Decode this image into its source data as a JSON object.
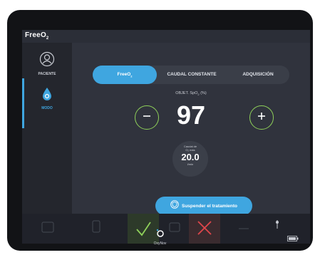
{
  "app": {
    "title": "Free",
    "title_sub": "O",
    "title_sub2": "2"
  },
  "sidebar": {
    "items": [
      {
        "label": "PACIENTE",
        "icon": "patient-icon"
      },
      {
        "label": "MODO",
        "icon": "oxygen-drop-icon"
      }
    ]
  },
  "tabs": [
    {
      "label": "FreeO",
      "label_sub": "2",
      "active": true
    },
    {
      "label": "CAUDAL CONSTANTE",
      "active": false
    },
    {
      "label": "ADQUISICIÓN",
      "active": false
    }
  ],
  "objective": {
    "label": "OBJET. SpO",
    "label_sub": "2",
    "label_unit": "(%)",
    "value": "97"
  },
  "flow": {
    "label_line1": "Caudal de",
    "label_line2": "O₂ más",
    "value": "20.0",
    "unit": "l/min"
  },
  "suspend_button": {
    "label": "Suspender el tratamiento"
  },
  "bottom_bar": {
    "confirm_icon": "check-icon",
    "cancel_icon": "close-icon",
    "battery_icon": "battery-icon",
    "wifi_icon": "signal-icon"
  },
  "brand": {
    "name": "OxyNov"
  },
  "colors": {
    "accent": "#3fa6e0",
    "confirm": "#8fd15a",
    "cancel": "#e0464b",
    "background": "#2b2e37"
  }
}
